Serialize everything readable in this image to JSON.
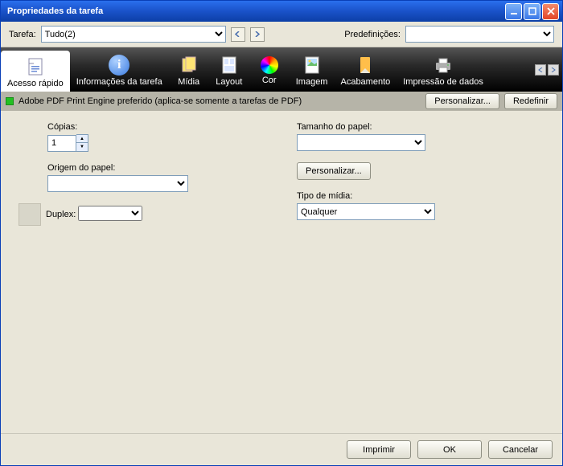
{
  "window_title": "Propriedades da tarefa",
  "toprow": {
    "tarefa_label": "Tarefa:",
    "tarefa_value": "Tudo(2)",
    "predef_label": "Predefinições:",
    "predef_value": ""
  },
  "tabs": {
    "acesso_rapido": "Acesso rápido",
    "info_tarefa": "Informações da tarefa",
    "midia": "Mídia",
    "layout": "Layout",
    "cor": "Cor",
    "imagem": "Imagem",
    "acabamento": "Acabamento",
    "impressao_dados": "Impressão de dados"
  },
  "infobar": {
    "text": "Adobe PDF Print Engine preferido (aplica-se somente a tarefas de PDF)",
    "personalizar": "Personalizar...",
    "redefinir": "Redefinir"
  },
  "fields": {
    "copias_label": "Cópias:",
    "copias_value": "1",
    "origem_label": "Origem do papel:",
    "duplex_label": "Duplex:",
    "tamanho_label": "Tamanho do papel:",
    "personalizar_btn": "Personalizar...",
    "tipo_label": "Tipo de mídia:",
    "tipo_value": "Qualquer"
  },
  "footer": {
    "imprimir": "Imprimir",
    "ok": "OK",
    "cancelar": "Cancelar"
  }
}
